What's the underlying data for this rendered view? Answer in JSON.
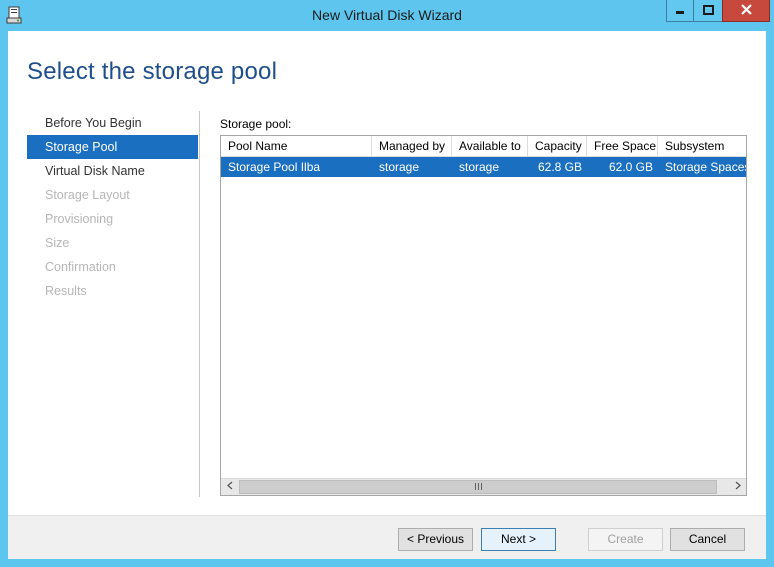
{
  "window": {
    "title": "New Virtual Disk Wizard"
  },
  "page": {
    "heading": "Select the storage pool"
  },
  "nav": {
    "items": [
      {
        "label": "Before You Begin",
        "state": "normal"
      },
      {
        "label": "Storage Pool",
        "state": "active"
      },
      {
        "label": "Virtual Disk Name",
        "state": "normal"
      },
      {
        "label": "Storage Layout",
        "state": "disabled"
      },
      {
        "label": "Provisioning",
        "state": "disabled"
      },
      {
        "label": "Size",
        "state": "disabled"
      },
      {
        "label": "Confirmation",
        "state": "disabled"
      },
      {
        "label": "Results",
        "state": "disabled"
      }
    ]
  },
  "pool": {
    "label": "Storage pool:",
    "columns": [
      "Pool Name",
      "Managed by",
      "Available to",
      "Capacity",
      "Free Space",
      "Subsystem"
    ],
    "rows": [
      [
        "Storage Pool Ilba",
        "storage",
        "storage",
        "62.8 GB",
        "62.0 GB",
        "Storage Spaces"
      ]
    ],
    "selected_row": 0
  },
  "buttons": {
    "previous": "< Previous",
    "next": "Next >",
    "create": "Create",
    "cancel": "Cancel"
  },
  "colors": {
    "accent": "#1b6fc0",
    "title_bar": "#5ec6ee",
    "heading": "#1e4f8c",
    "close_button": "#c7483c"
  },
  "icons": {
    "app": "virtual-disk-wizard-icon",
    "minimize": "minimize-icon",
    "maximize": "maximize-icon",
    "close": "close-icon",
    "scroll_left": "chevron-left-icon",
    "scroll_right": "chevron-right-icon",
    "scroll_grip": "grip-icon"
  }
}
